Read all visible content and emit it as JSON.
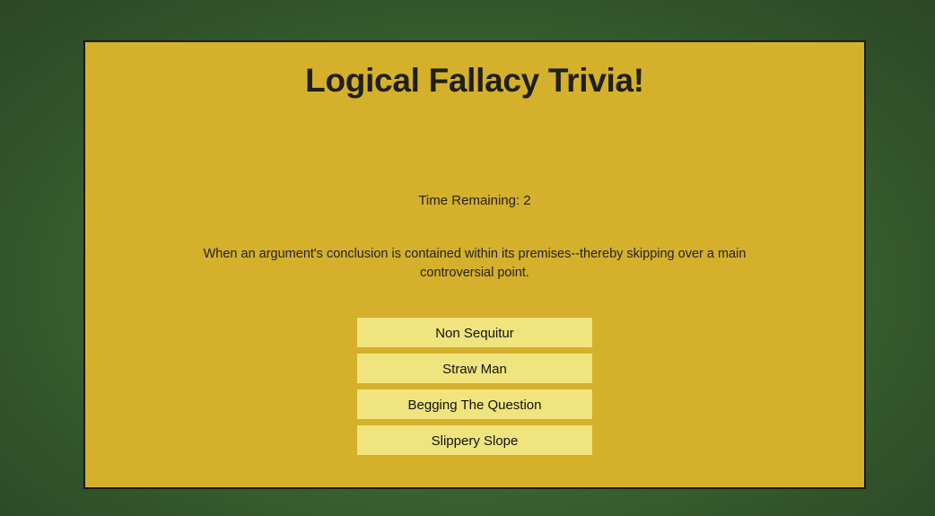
{
  "game": {
    "title": "Logical Fallacy Trivia!",
    "timer_text": "Time Remaining: 2",
    "question": "When an argument's conclusion is contained within its premises--thereby skipping over a main controversial point.",
    "answers": [
      {
        "label": "Non Sequitur"
      },
      {
        "label": "Straw Man"
      },
      {
        "label": "Begging The Question"
      },
      {
        "label": "Slippery Slope"
      }
    ]
  },
  "colors": {
    "background": "#3f6b34",
    "board": "#d5b02b",
    "answer_button": "#f0e47f",
    "text": "#1f1f1a"
  }
}
